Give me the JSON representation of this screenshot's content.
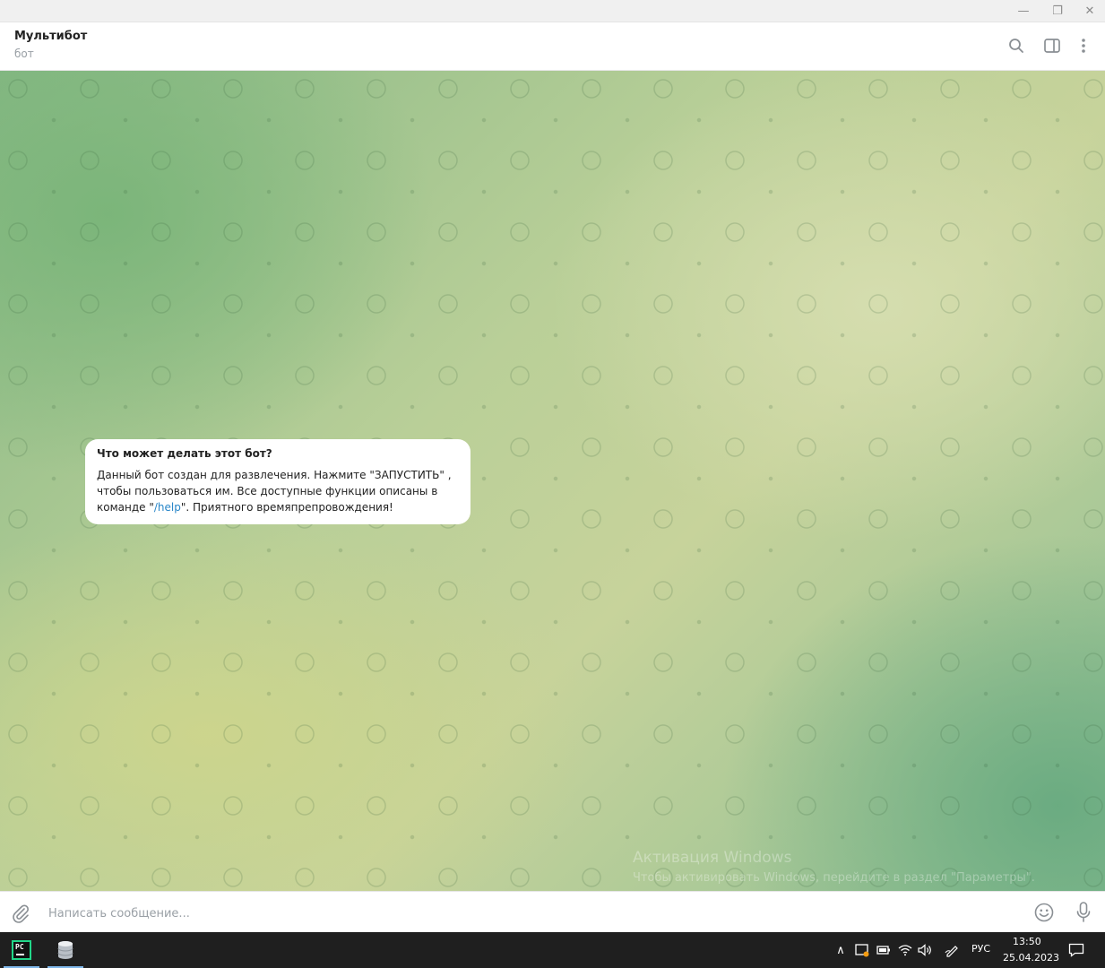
{
  "window": {
    "minimize_glyph": "—",
    "maximize_glyph": "❐",
    "close_glyph": "✕"
  },
  "header": {
    "title": "Мультибот",
    "subtitle": "бот",
    "icons": [
      "search-icon",
      "side-panel-icon",
      "more-vertical-icon"
    ]
  },
  "chat": {
    "bubble_title": "Что может делать этот бот?",
    "bubble_text_part1": "Данный бот создан для развлечения. Нажмите \"ЗАПУСТИТЬ\" , чтобы пользоваться им. Все доступные функции описаны в команде \"",
    "bubble_link": "/help",
    "bubble_text_part2": "\". Приятного времяпрепровождения!",
    "watermark_line1": "Активация Windows",
    "watermark_line2": "Чтобы активировать Windows, перейдите в раздел \"Параметры\"."
  },
  "composer": {
    "placeholder": "Написать сообщение...",
    "icons": [
      "paperclip-icon",
      "emoji-icon",
      "microphone-icon"
    ]
  },
  "taskbar": {
    "apps": [
      "pycharm-icon",
      "database-icon"
    ],
    "pycharm_label": "PC",
    "tray_chevron": "∧",
    "language": "РУС",
    "time": "13:50",
    "date": "25.04.2023"
  },
  "colors": {
    "link": "#2a87c9",
    "taskbar": "#1f1f1f",
    "accent_underline": "#7fb7ea"
  }
}
